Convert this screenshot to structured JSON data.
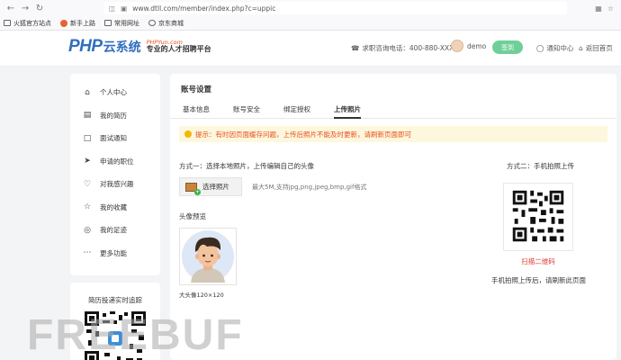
{
  "browser": {
    "url": "www.dtll.com/member/index.php?c=uppic",
    "bookmarks": [
      {
        "label": "火狐官方站点",
        "icon": "folder-icon"
      },
      {
        "label": "新手上路",
        "icon": "firefox-icon"
      },
      {
        "label": "常用网址",
        "icon": "folder-icon"
      },
      {
        "label": "京东商城",
        "icon": "globe-icon"
      }
    ]
  },
  "header": {
    "logo_brand": "PHP",
    "logo_cn": "云系统",
    "logo_domain": "PHPYun.com",
    "logo_slogan": "专业的人才招聘平台",
    "hotline": "求职咨询电话：400-880-XXXX",
    "username": "demo",
    "signin_label": "签到",
    "notify_label": "通知中心",
    "home_label": "返回首页"
  },
  "sidebar": {
    "items": [
      {
        "label": "个人中心",
        "icon": "home-icon"
      },
      {
        "label": "我的简历",
        "icon": "resume-icon"
      },
      {
        "label": "面试通知",
        "icon": "message-icon"
      },
      {
        "label": "申请的职位",
        "icon": "send-icon"
      },
      {
        "label": "对我感兴趣",
        "icon": "heart-icon"
      },
      {
        "label": "我的收藏",
        "icon": "star-icon"
      },
      {
        "label": "我的足迹",
        "icon": "footprint-icon"
      },
      {
        "label": "更多功能",
        "icon": "more-icon"
      }
    ],
    "qr_card_title": "简历投递实时追踪"
  },
  "main": {
    "title": "账号设置",
    "tabs": [
      {
        "label": "基本信息",
        "active": false
      },
      {
        "label": "账号安全",
        "active": false
      },
      {
        "label": "绑定授权",
        "active": false
      },
      {
        "label": "上传照片",
        "active": true
      }
    ],
    "tip": "提示：有时因页面缓存问题，上传后照片不能及时更新，请刷新页面即可",
    "method1": "方式一：选择本地照片，上传编辑自己的头像",
    "choose_button": "选择照片",
    "limit_text": "最大5M,支持jpg,png,jpeg,bmp,gif格式",
    "preview_label": "头像预览",
    "preview_caption": "大头像120×120",
    "method2": "方式二：手机拍照上传",
    "scan_label": "扫描二维码",
    "scan_note": "手机拍照上传后，请刷新此页面"
  },
  "watermark": "FREEBUF",
  "colors": {
    "accent_orange": "#e94e1b",
    "brand_blue": "#2f6fc0",
    "signin_green": "#6fcf97",
    "scan_red": "#e03c31"
  }
}
